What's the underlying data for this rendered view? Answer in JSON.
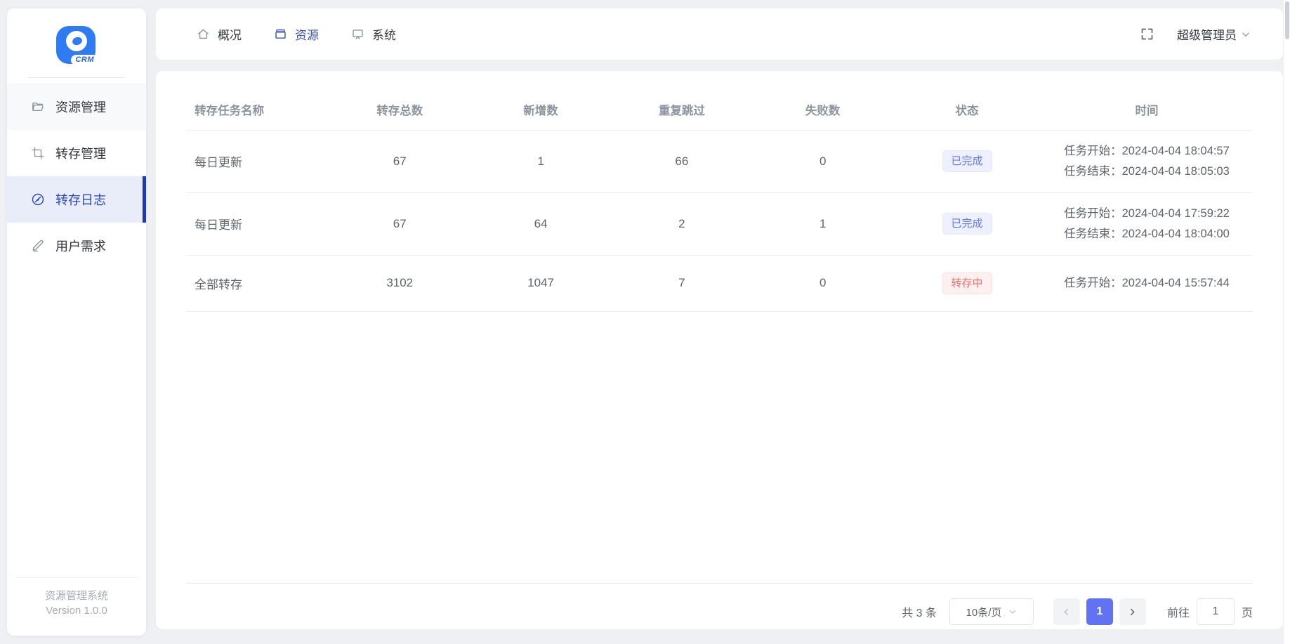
{
  "brand": {
    "logo_text": "CRM",
    "system_name": "资源管理系统",
    "version": "Version 1.0.0"
  },
  "sidebar": {
    "items": [
      {
        "label": "资源管理",
        "icon": "folder-icon",
        "active": false
      },
      {
        "label": "转存管理",
        "icon": "crop-icon",
        "active": false
      },
      {
        "label": "转存日志",
        "icon": "compass-icon",
        "active": true
      },
      {
        "label": "用户需求",
        "icon": "edit-icon",
        "active": false
      }
    ]
  },
  "topnav": {
    "items": [
      {
        "label": "概况",
        "icon": "home-icon",
        "active": false
      },
      {
        "label": "资源",
        "icon": "archive-icon",
        "active": true
      },
      {
        "label": "系统",
        "icon": "monitor-icon",
        "active": false
      }
    ],
    "user_label": "超级管理员"
  },
  "table": {
    "columns": [
      "转存任务名称",
      "转存总数",
      "新增数",
      "重复跳过",
      "失败数",
      "状态",
      "时间"
    ],
    "rows": [
      {
        "name": "每日更新",
        "total": "67",
        "added": "1",
        "skipped": "66",
        "failed": "0",
        "status": "已完成",
        "status_type": "done",
        "time_start_label": "任务开始：",
        "time_start": "2024-04-04 18:04:57",
        "time_end_label": "任务结束：",
        "time_end": "2024-04-04 18:05:03"
      },
      {
        "name": "每日更新",
        "total": "67",
        "added": "64",
        "skipped": "2",
        "failed": "1",
        "status": "已完成",
        "status_type": "done",
        "time_start_label": "任务开始：",
        "time_start": "2024-04-04 17:59:22",
        "time_end_label": "任务结束：",
        "time_end": "2024-04-04 18:04:00"
      },
      {
        "name": "全部转存",
        "total": "3102",
        "added": "1047",
        "skipped": "7",
        "failed": "0",
        "status": "转存中",
        "status_type": "running",
        "time_start_label": "任务开始：",
        "time_start": "2024-04-04 15:57:44"
      }
    ]
  },
  "pagination": {
    "total_text": "共 3 条",
    "page_size": "10条/页",
    "current_page": "1",
    "goto_label": "前往",
    "goto_value": "1",
    "goto_unit": "页"
  },
  "colors": {
    "primary_blue": "#2f7bf4",
    "nav_active": "#3a50c9",
    "sidebar_active_bg": "#e9edf9",
    "sidebar_active_bar": "#1e38b5",
    "status_done_text": "#6276f5",
    "status_done_bg": "#eef1fd",
    "status_running_text": "#f26d6d",
    "status_running_bg": "#fdf0f0",
    "active_page_bg": "#6172f3",
    "page_bg": "#eef0f4"
  }
}
